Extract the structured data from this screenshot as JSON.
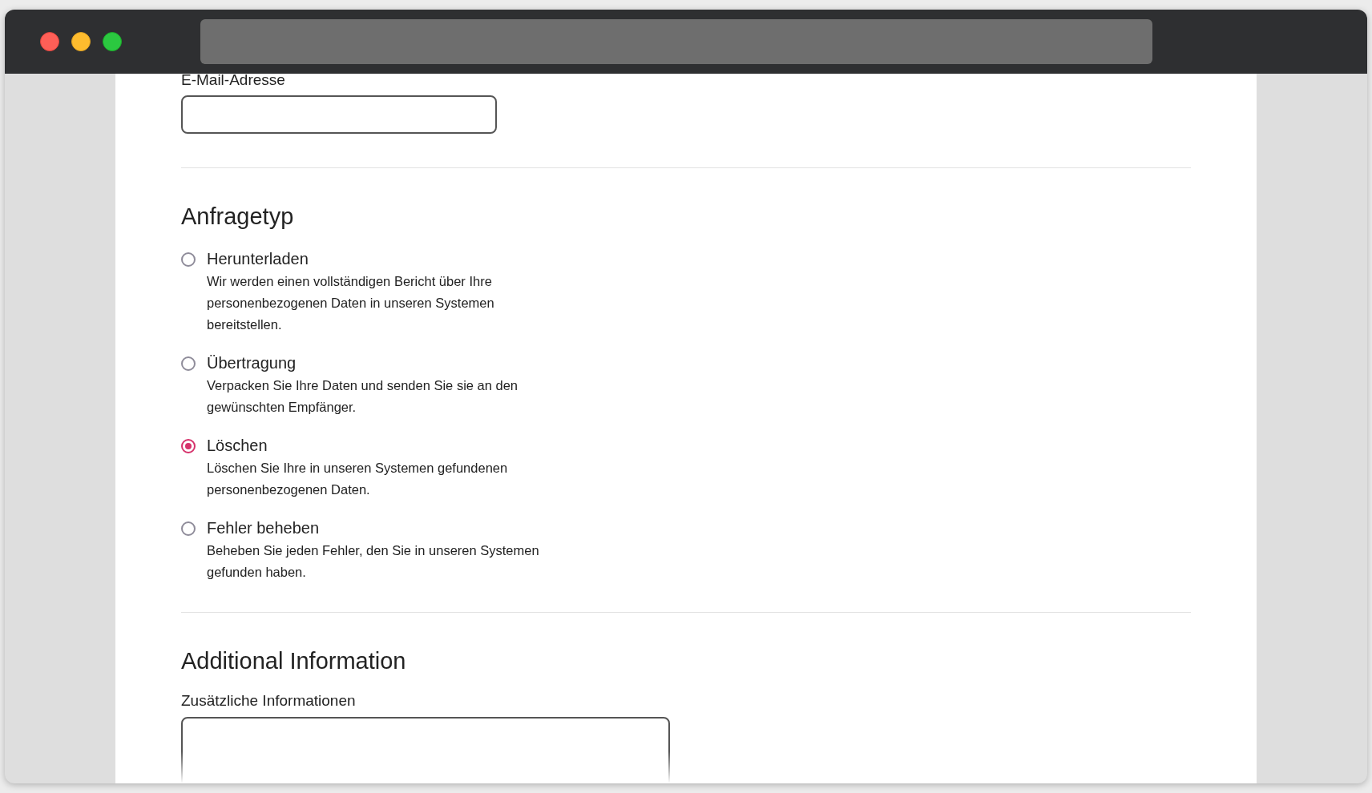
{
  "email": {
    "label": "E-Mail-Adresse"
  },
  "request_type": {
    "heading": "Anfragetyp",
    "options": [
      {
        "label": "Herunterladen",
        "description": "Wir werden einen vollständigen Bericht über Ihre personenbezogenen Daten in unseren Systemen bereitstellen.",
        "selected": false
      },
      {
        "label": "Übertragung",
        "description": "Verpacken Sie Ihre Daten und senden Sie sie an den gewünschten Empfänger.",
        "selected": false
      },
      {
        "label": "Löschen",
        "description": "Löschen Sie Ihre in unseren Systemen gefundenen personenbezogenen Daten.",
        "selected": true
      },
      {
        "label": "Fehler beheben",
        "description": "Beheben Sie jeden Fehler, den Sie in unseren Systemen gefunden haben.",
        "selected": false
      }
    ]
  },
  "additional_information": {
    "heading": "Additional Information",
    "label": "Zusätzliche Informationen"
  }
}
